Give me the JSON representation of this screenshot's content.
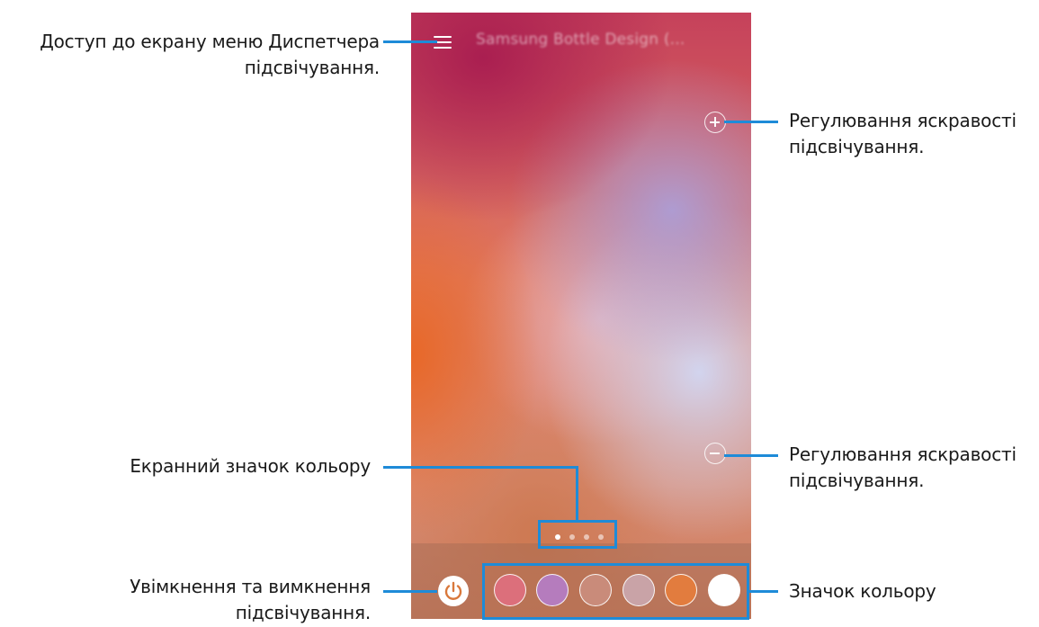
{
  "screen": {
    "title": "Samsung Bottle Design (..."
  },
  "callouts": {
    "menu_access": [
      "Доступ до екрану меню Диспетчера",
      "підсвічування."
    ],
    "brightness_up": [
      "Регулювання яскравості",
      "підсвічування."
    ],
    "brightness_down": [
      "Регулювання яскравості",
      "підсвічування."
    ],
    "screen_color_icon": [
      "Екранний значок кольору"
    ],
    "power_toggle": [
      "Увімкнення та вимкнення",
      "підсвічування."
    ],
    "color_icon": [
      "Значок кольору"
    ]
  },
  "page_indicator": {
    "count": 4,
    "active_index": 0
  },
  "color_swatches": [
    {
      "name": "rose",
      "color": "#dc6f7b"
    },
    {
      "name": "violet",
      "color": "#b57cbd"
    },
    {
      "name": "terracotta",
      "color": "#c98b7a"
    },
    {
      "name": "dusty-pink",
      "color": "#c9a3a7"
    },
    {
      "name": "orange",
      "color": "#e27c3e"
    },
    {
      "name": "white",
      "color": "#ffffff"
    }
  ],
  "colors": {
    "accent": "#1e8bd8",
    "power_icon": "#d9783b"
  },
  "icons": {
    "menu": "hamburger-menu-icon",
    "brightness_up": "plus-circle-icon",
    "brightness_down": "minus-circle-icon",
    "power": "power-icon"
  }
}
